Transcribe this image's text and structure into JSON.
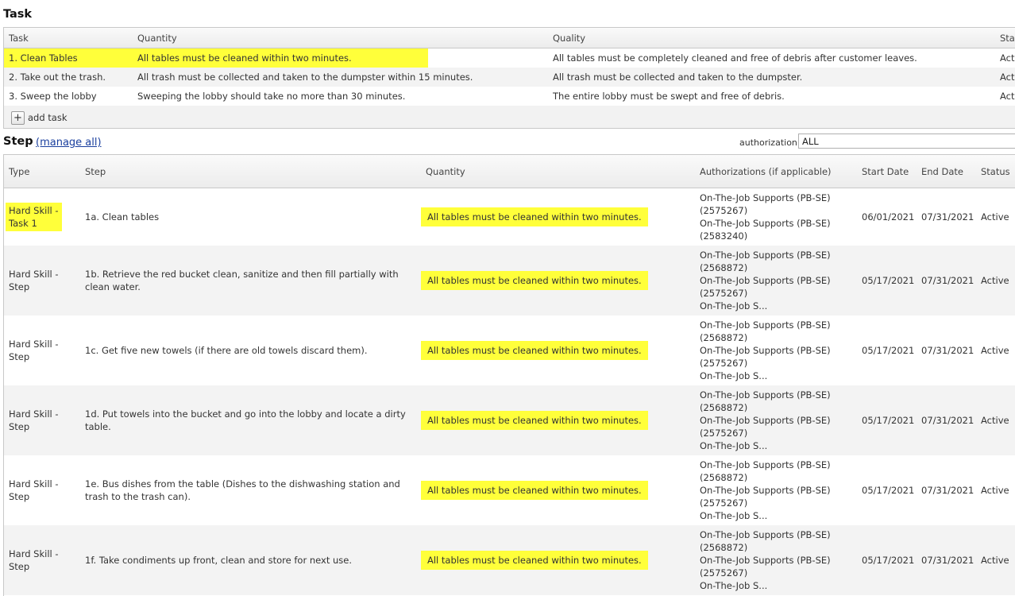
{
  "task_section": {
    "title": "Task",
    "columns": [
      "Task",
      "Quantity",
      "Quality",
      "Stat"
    ],
    "rows": [
      {
        "task": "1. Clean Tables",
        "quantity": "All tables must be cleaned within two minutes.",
        "quality": "All tables must be completely cleaned and free of debris after customer leaves.",
        "status": "Acti"
      },
      {
        "task": "2. Take out the trash.",
        "quantity": "All trash must be collected and taken to the dumpster within 15 minutes.",
        "quality": "All trash must be collected and taken to the dumpster.",
        "status": "Acti"
      },
      {
        "task": "3. Sweep the lobby",
        "quantity": "Sweeping the lobby should take no more than 30 minutes.",
        "quality": "The entire lobby must be swept and free of debris.",
        "status": "Acti"
      }
    ],
    "add_label": "add task"
  },
  "step_section": {
    "title": "Step",
    "manage_all": "(manage all)",
    "authorization_label": "authorization:",
    "authorization_value": "ALL",
    "columns": [
      "Type",
      "Step",
      "Quantity",
      "Authorizations (if applicable)",
      "Start Date",
      "End Date",
      "Status"
    ],
    "rows": [
      {
        "type": "Hard Skill -\nTask 1",
        "step": "1a. Clean tables",
        "quantity": "All tables must be cleaned within two minutes.",
        "auth": "On-The-Job Supports (PB-SE)\n(2575267)\nOn-The-Job Supports (PB-SE)\n(2583240)",
        "start": "06/01/2021",
        "end": "07/31/2021",
        "status": "Active"
      },
      {
        "type": "Hard Skill -\nStep",
        "step": "1b. Retrieve the red bucket clean, sanitize and then fill partially with clean water.",
        "quantity": "All tables must be cleaned within two minutes.",
        "auth": "On-The-Job Supports (PB-SE)\n(2568872)\nOn-The-Job Supports (PB-SE)\n(2575267)\nOn-The-Job S...",
        "start": "05/17/2021",
        "end": "07/31/2021",
        "status": "Active"
      },
      {
        "type": "Hard Skill -\nStep",
        "step": "1c. Get five new towels (if there are old towels discard them).",
        "quantity": "All tables must be cleaned within two minutes.",
        "auth": "On-The-Job Supports (PB-SE)\n(2568872)\nOn-The-Job Supports (PB-SE)\n(2575267)\nOn-The-Job S...",
        "start": "05/17/2021",
        "end": "07/31/2021",
        "status": "Active"
      },
      {
        "type": "Hard Skill -\nStep",
        "step": "1d. Put towels into the bucket and go into the lobby and locate a dirty table.",
        "quantity": "All tables must be cleaned within two minutes.",
        "auth": "On-The-Job Supports (PB-SE)\n(2568872)\nOn-The-Job Supports (PB-SE)\n(2575267)\nOn-The-Job S...",
        "start": "05/17/2021",
        "end": "07/31/2021",
        "status": "Active"
      },
      {
        "type": "Hard Skill -\nStep",
        "step": "1e. Bus dishes from the table (Dishes to the dishwashing station and trash to the trash can).",
        "quantity": "All tables must be cleaned within two minutes.",
        "auth": "On-The-Job Supports (PB-SE)\n(2568872)\nOn-The-Job Supports (PB-SE)\n(2575267)\nOn-The-Job S...",
        "start": "05/17/2021",
        "end": "07/31/2021",
        "status": "Active"
      },
      {
        "type": "Hard Skill -\nStep",
        "step": "1f. Take condiments up front, clean and store for next use.",
        "quantity": "All tables must be cleaned within two minutes.",
        "auth": "On-The-Job Supports (PB-SE)\n(2568872)\nOn-The-Job Supports (PB-SE)\n(2575267)\nOn-The-Job S...",
        "start": "05/17/2021",
        "end": "07/31/2021",
        "status": "Active"
      }
    ]
  },
  "colors": {
    "highlight": "#ffff3a",
    "link": "#1a3f9e"
  },
  "icons": {
    "add": "plus-icon"
  }
}
